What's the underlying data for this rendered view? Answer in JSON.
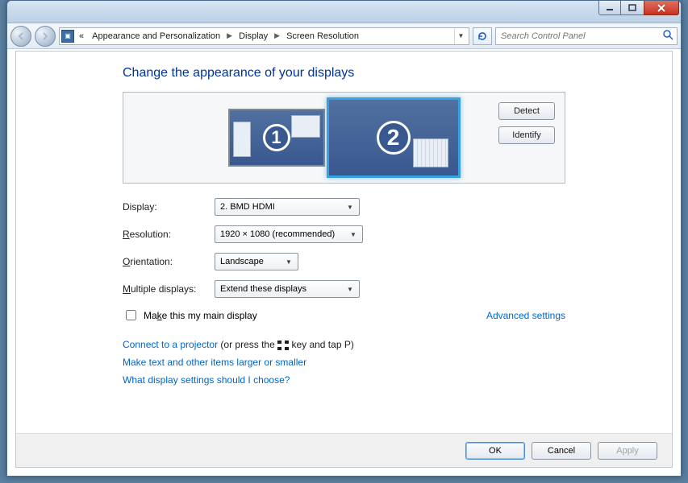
{
  "breadcrumb": {
    "cat": "Appearance and Personalization",
    "sub": "Display",
    "page": "Screen Resolution"
  },
  "search": {
    "placeholder": "Search Control Panel"
  },
  "title": "Change the appearance of your displays",
  "monitors": {
    "m1": "1",
    "m2": "2"
  },
  "side": {
    "detect": "Detect",
    "identify": "Identify"
  },
  "form": {
    "display_label": "Display:",
    "display_value": "2. BMD HDMI",
    "resolution_label_pre": "R",
    "resolution_label_post": "esolution:",
    "resolution_value": "1920 × 1080 (recommended)",
    "orientation_label_pre": "O",
    "orientation_label_post": "rientation:",
    "orientation_value": "Landscape",
    "multi_label_pre": "M",
    "multi_label_post": "ultiple displays:",
    "multi_value": "Extend these displays"
  },
  "checkbox": {
    "label_pre": "Ma",
    "label_u": "k",
    "label_post": "e this my main display"
  },
  "advanced": "Advanced settings",
  "links": {
    "projector": "Connect to a projector",
    "projector_hint_a": " (or press the ",
    "projector_hint_b": " key and tap P)",
    "textsize": "Make text and other items larger or smaller",
    "help": "What display settings should I choose?"
  },
  "footer": {
    "ok": "OK",
    "cancel": "Cancel",
    "apply": "Apply"
  }
}
